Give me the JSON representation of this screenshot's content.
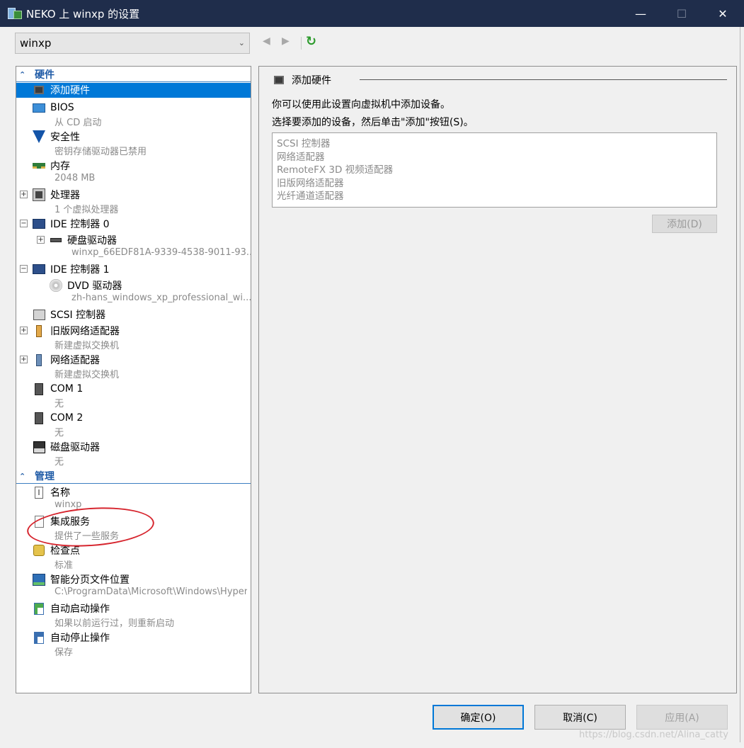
{
  "window": {
    "title": "NEKO 上 winxp 的设置",
    "min": "—",
    "max": "☐",
    "close": "✕"
  },
  "toolbar": {
    "vm_selected": "winxp",
    "back": "◀",
    "forward": "▶",
    "refresh": "↻"
  },
  "tree": {
    "hardware_header": "硬件",
    "management_header": "管理",
    "hardware": [
      {
        "label": "添加硬件",
        "sub": ""
      },
      {
        "label": "BIOS",
        "sub": "从 CD 启动"
      },
      {
        "label": "安全性",
        "sub": "密钥存储驱动器已禁用"
      },
      {
        "label": "内存",
        "sub": "2048 MB"
      },
      {
        "label": "处理器",
        "sub": "1 个虚拟处理器"
      },
      {
        "label": "IDE 控制器 0",
        "sub": ""
      },
      {
        "label": "硬盘驱动器",
        "sub": "winxp_66EDF81A-9339-4538-9011-93..."
      },
      {
        "label": "IDE 控制器 1",
        "sub": ""
      },
      {
        "label": "DVD 驱动器",
        "sub": "zh-hans_windows_xp_professional_wi..."
      },
      {
        "label": "SCSI 控制器",
        "sub": ""
      },
      {
        "label": "旧版网络适配器",
        "sub": "新建虚拟交换机"
      },
      {
        "label": "网络适配器",
        "sub": "新建虚拟交换机"
      },
      {
        "label": "COM 1",
        "sub": "无"
      },
      {
        "label": "COM 2",
        "sub": "无"
      },
      {
        "label": "磁盘驱动器",
        "sub": "无"
      }
    ],
    "management": [
      {
        "label": "名称",
        "sub": "winxp"
      },
      {
        "label": "集成服务",
        "sub": "提供了一些服务"
      },
      {
        "label": "检查点",
        "sub": "标准"
      },
      {
        "label": "智能分页文件位置",
        "sub": "C:\\ProgramData\\Microsoft\\Windows\\Hyper-V"
      },
      {
        "label": "自动启动操作",
        "sub": "如果以前运行过，则重新启动"
      },
      {
        "label": "自动停止操作",
        "sub": "保存"
      }
    ]
  },
  "panel": {
    "title": "添加硬件",
    "desc1": "你可以使用此设置向虚拟机中添加设备。",
    "desc2": "选择要添加的设备，然后单击\"添加\"按钮(S)。",
    "devices": [
      "SCSI 控制器",
      "网络适配器",
      "RemoteFX 3D 视频适配器",
      "旧版网络适配器",
      "光纤通道适配器"
    ],
    "add_button": "添加(D)"
  },
  "footer": {
    "ok": "确定(O)",
    "cancel": "取消(C)",
    "apply": "应用(A)",
    "watermark": "https://blog.csdn.net/Alina_catty"
  },
  "colors": {
    "selection": "#0078d7",
    "titlebar": "#1f2d4b",
    "section_header": "#1e5aa6",
    "annotation": "#d6242d"
  }
}
